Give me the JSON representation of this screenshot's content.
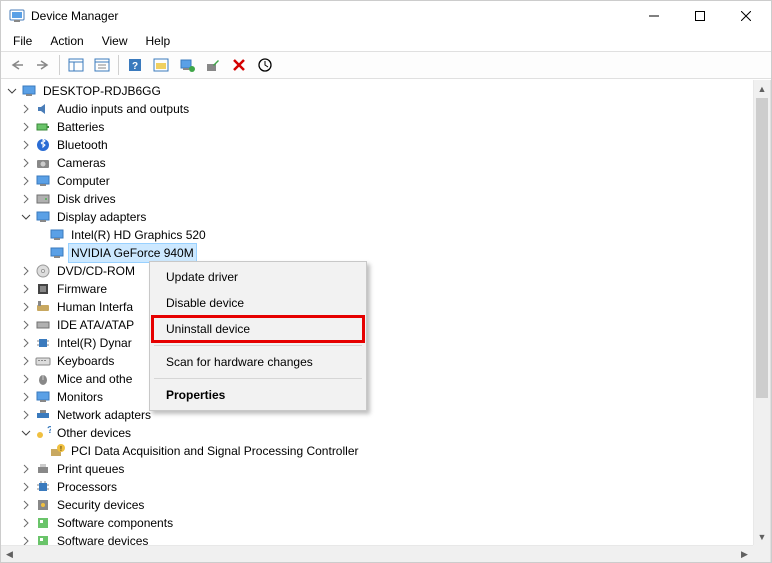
{
  "window": {
    "title": "Device Manager"
  },
  "menu": {
    "file": "File",
    "action": "Action",
    "view": "View",
    "help": "Help"
  },
  "tree": {
    "root": "DESKTOP-RDJB6GG",
    "audio": "Audio inputs and outputs",
    "batteries": "Batteries",
    "bluetooth": "Bluetooth",
    "cameras": "Cameras",
    "computer": "Computer",
    "diskdrives": "Disk drives",
    "display": "Display adapters",
    "display_intel": "Intel(R) HD Graphics 520",
    "display_nvidia": "NVIDIA GeForce 940M",
    "dvd": "DVD/CD-ROM",
    "firmware": "Firmware",
    "hid": "Human Interfa",
    "ide": "IDE ATA/ATAP",
    "inteldyn": "Intel(R) Dynar",
    "keyboards": "Keyboards",
    "mice": "Mice and othe",
    "monitors": "Monitors",
    "network": "Network adapters",
    "other": "Other devices",
    "other_pci": "PCI Data Acquisition and Signal Processing Controller",
    "printq": "Print queues",
    "processors": "Processors",
    "security": "Security devices",
    "swcomp": "Software components",
    "swdev": "Software devices"
  },
  "ctx": {
    "update": "Update driver",
    "disable": "Disable device",
    "uninstall": "Uninstall device",
    "scan": "Scan for hardware changes",
    "properties": "Properties"
  }
}
